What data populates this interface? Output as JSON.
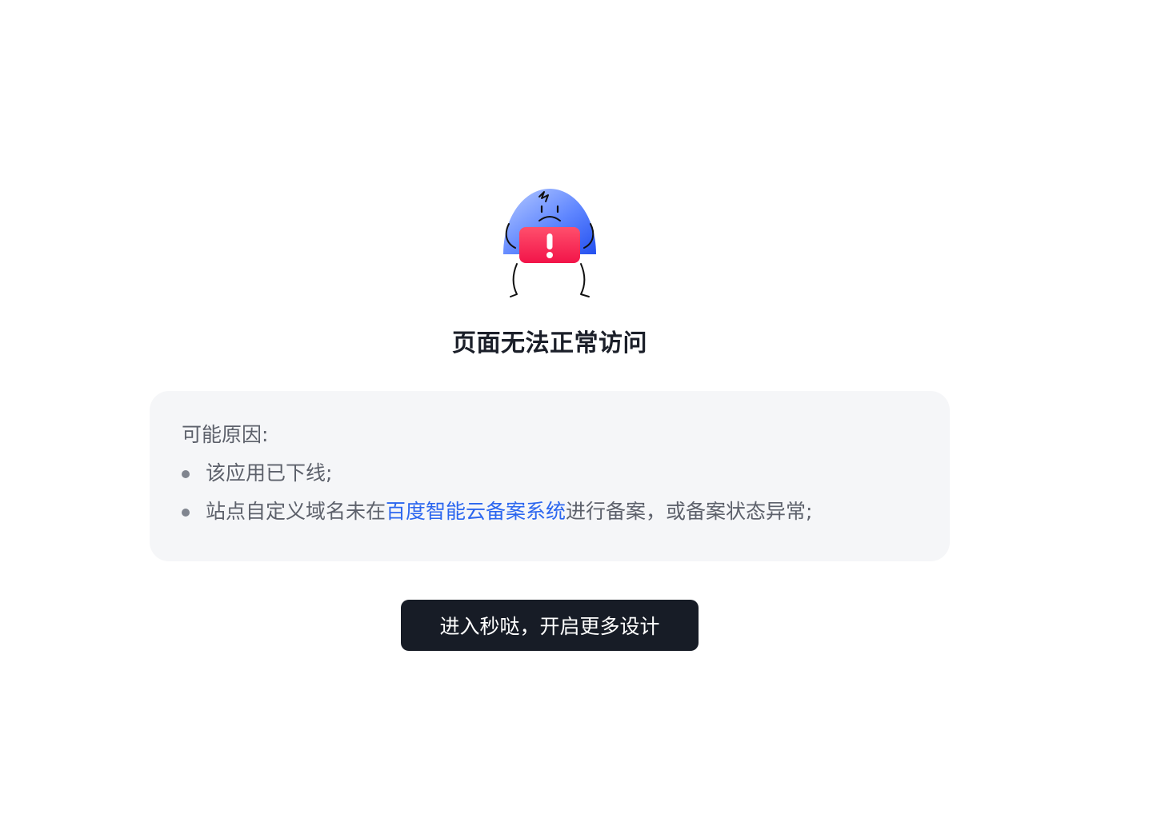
{
  "error": {
    "title": "页面无法正常访问",
    "mascot_icon": "sad-helmet-alert-icon",
    "colors": {
      "helmet_top": "#a9c2ff",
      "helmet_bottom": "#2e5bf0",
      "alert_top": "#ff4d6a",
      "alert_bottom": "#f0164a"
    }
  },
  "reasons": {
    "heading": "可能原因:",
    "items": [
      {
        "text": "该应用已下线;"
      },
      {
        "text_before": "站点自定义域名未在",
        "link": "百度智能云备案系统",
        "text_after": "进行备案，或备案状态异常;"
      }
    ]
  },
  "cta": {
    "label": "进入秒哒，开启更多设计"
  },
  "colors": {
    "link": "#2b66ef",
    "button_bg": "#171c26",
    "card_bg": "#f5f6f8"
  }
}
